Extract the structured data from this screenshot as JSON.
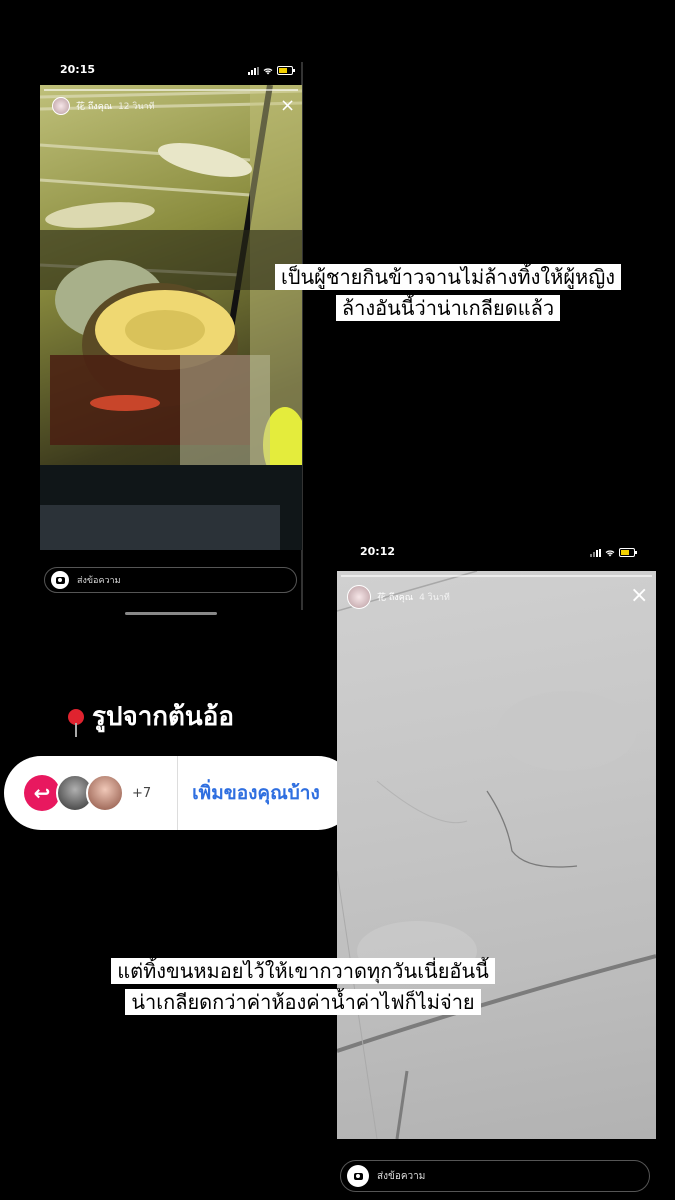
{
  "story1": {
    "status_time": "20:15",
    "user_name": "花 ถึงคุณ",
    "time_ago": "12 วินาที",
    "close_icon": "×",
    "message_placeholder": "ส่งข้อความ",
    "caption_line1": "เป็นผู้ชายกินข้าวจานไม่ล้างทิ้งให้ผู้หญิง",
    "caption_line2": "ล้างอันนี้ว่าน่าเกลียดแล้ว"
  },
  "story2": {
    "status_time": "20:12",
    "user_name": "花 ถึงคุณ",
    "time_ago": "4 วินาที",
    "close_icon": "×",
    "message_placeholder": "ส่งข้อความ",
    "caption_line1": "แต่ทิ้งขนหมอยไว้ให้เขากวาดทุกวันเนี่ยอันนี้",
    "caption_line2": "น่าเกลียดกว่าค่าห้องค่าน้ำค่าไฟก็ไม่จ่าย"
  },
  "sticker": {
    "pin_text": "รูปจากต้นอ้อ",
    "reply_count": "+7",
    "add_yours_label": "เพิ่มของคุณบ้าง"
  },
  "colors": {
    "reply_pink": "#e8185f",
    "add_yours_blue": "#2f6fe0",
    "pin_red": "#e0232f",
    "battery_yellow": "#f2d000"
  },
  "icons": [
    "signal-icon",
    "wifi-icon",
    "battery-icon",
    "close-icon",
    "camera-icon",
    "pin-icon",
    "reply-icon"
  ]
}
